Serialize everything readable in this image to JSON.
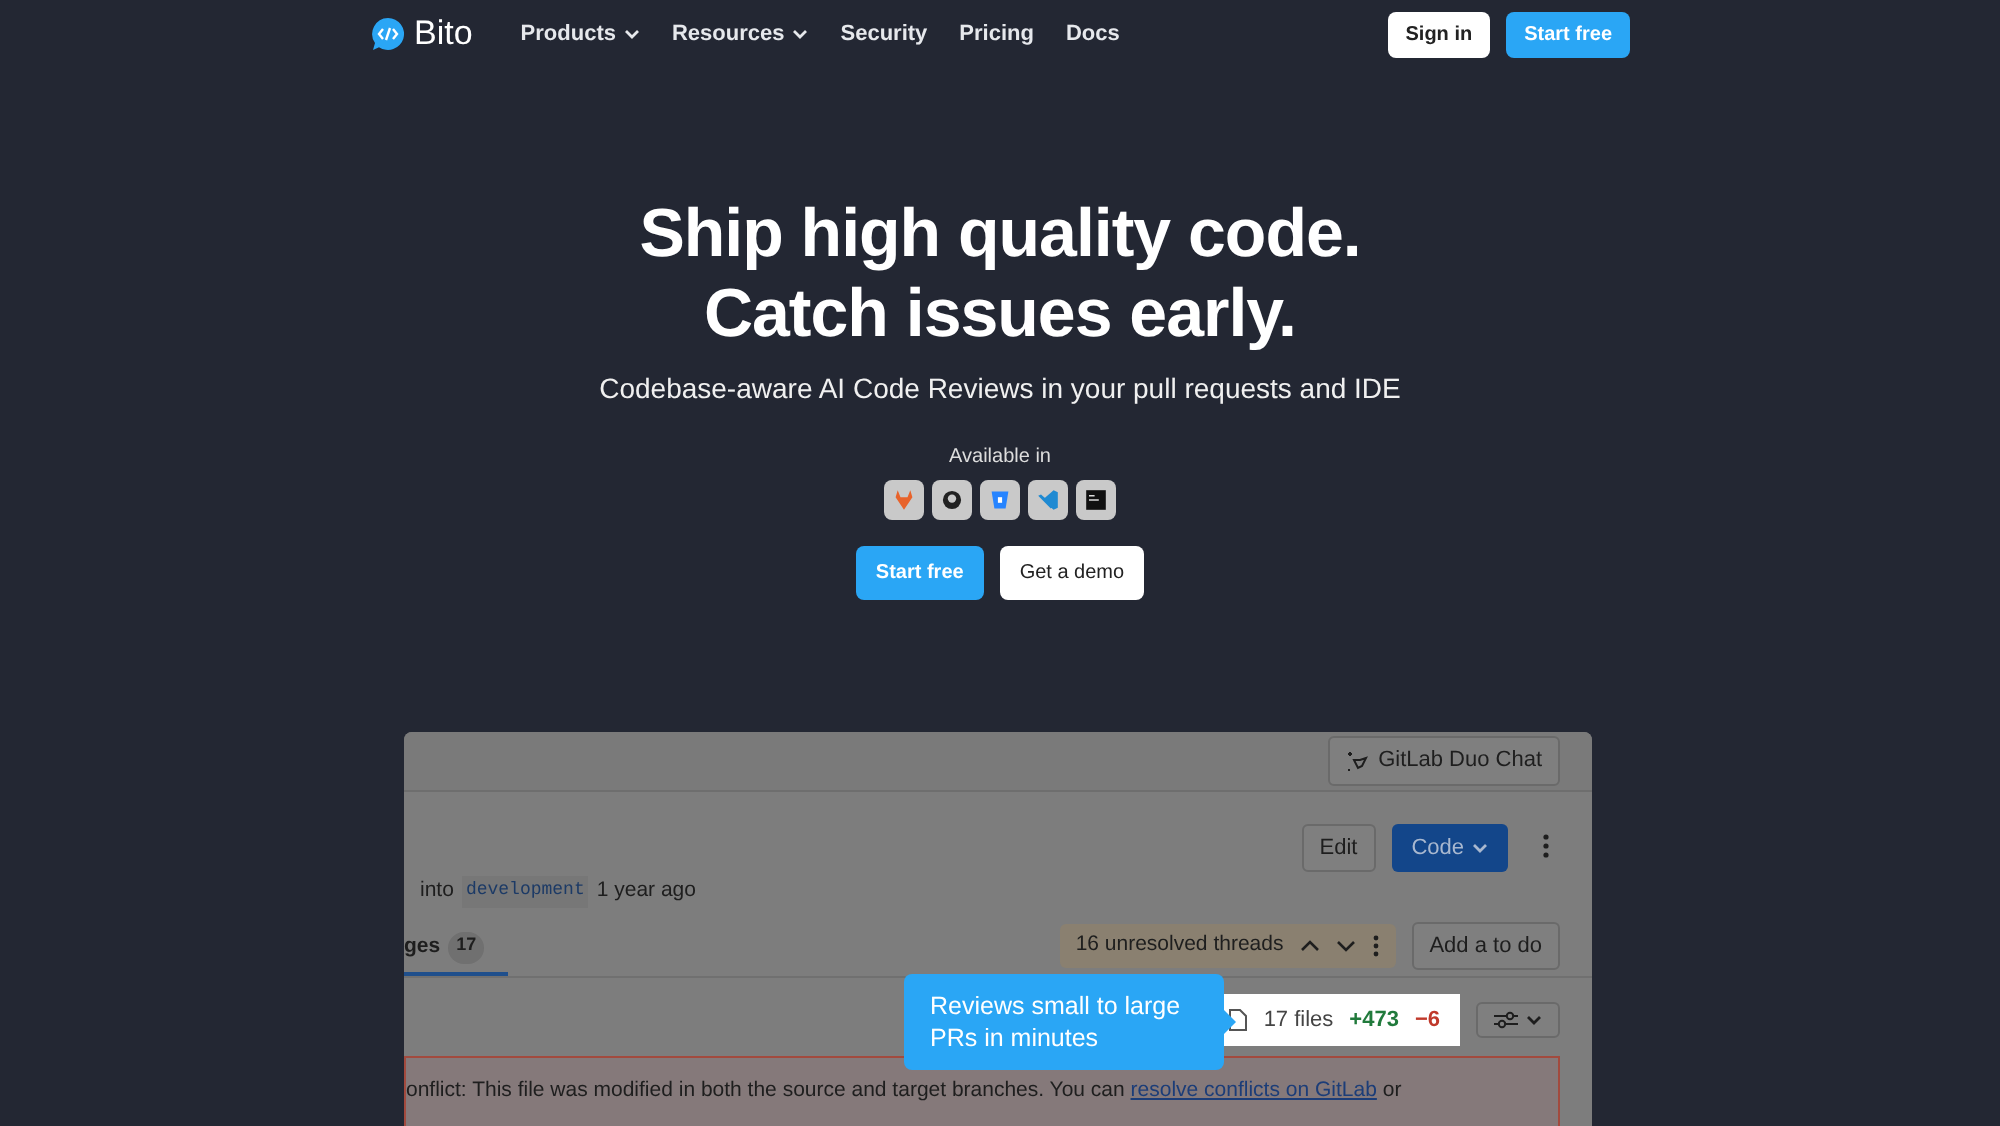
{
  "nav": {
    "brand": "Bito",
    "links": [
      {
        "label": "Products",
        "dropdown": true
      },
      {
        "label": "Resources",
        "dropdown": true
      },
      {
        "label": "Security",
        "dropdown": false
      },
      {
        "label": "Pricing",
        "dropdown": false
      },
      {
        "label": "Docs",
        "dropdown": false
      }
    ],
    "sign_in": "Sign in",
    "start": "Start free"
  },
  "hero": {
    "title_lines": [
      "Ship high quality code.",
      "Catch issues early."
    ],
    "subtitle": "Codebase-aware AI Code Reviews in your pull requests and IDE",
    "available_label": "Available in",
    "primary": "Start free",
    "secondary": "Get a demo"
  },
  "preview": {
    "duo_chat": "GitLab Duo Chat",
    "edit": "Edit",
    "code": "Code",
    "meta": {
      "into": "into",
      "branch": "development",
      "time": "1 year ago"
    },
    "tab": {
      "label": "ges",
      "count": "17",
      "selected": true
    },
    "threads": "16 unresolved threads",
    "add_todo": "Add a to do",
    "callout": "Reviews small to large PRs in minutes",
    "files": "17 files",
    "added": "+473",
    "removed": "−6",
    "alert": {
      "text": "onflict: This file was modified in both the source and target branches. You can",
      "link": "resolve conflicts on GitLab",
      "after": "or"
    }
  }
}
